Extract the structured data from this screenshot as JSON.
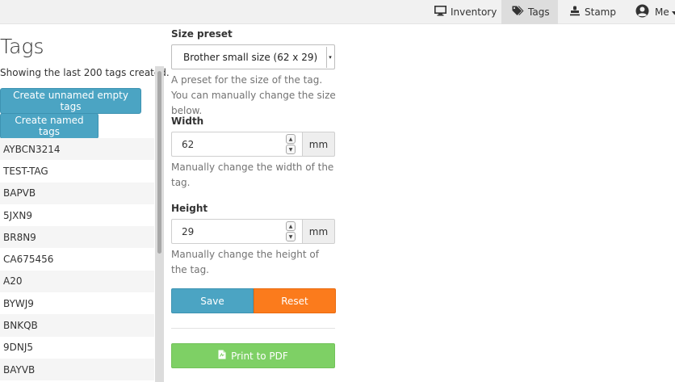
{
  "nav": {
    "items": [
      {
        "label": "Inventory",
        "icon": "monitor-icon",
        "active": false
      },
      {
        "label": "Tags",
        "icon": "tags-icon",
        "active": true
      },
      {
        "label": "Stamp",
        "icon": "stamp-icon",
        "active": false
      },
      {
        "label": "Me",
        "icon": "user-circle-icon",
        "active": false
      }
    ]
  },
  "page": {
    "title": "Tags",
    "subtitle": "Showing the last 200 tags created."
  },
  "actions": {
    "create_unnamed": "Create unnamed empty tags",
    "create_named": "Create named tags"
  },
  "tags": [
    "AYBCN3214",
    "TEST-TAG",
    "BAPVB",
    "5JXN9",
    "BR8N9",
    "CA675456",
    "A20",
    "BYWJ9",
    "BNKQB",
    "9DNJ5",
    "BAYVB"
  ],
  "form": {
    "size_preset": {
      "label": "Size preset",
      "value": "Brother small size (62 x 29)",
      "help": "A preset for the size of the tag. You can manually change the size below."
    },
    "width": {
      "label": "Width",
      "value": "62",
      "unit": "mm",
      "help": "Manually change the width of the tag."
    },
    "height": {
      "label": "Height",
      "value": "29",
      "unit": "mm",
      "help": "Manually change the height of the tag."
    },
    "save_label": "Save",
    "reset_label": "Reset",
    "print_label": "Print to PDF"
  },
  "colors": {
    "info": "#4ba4c3",
    "reset": "#fb7b1c",
    "print": "#7ed065",
    "nav_bg": "#f1f1f1",
    "nav_active": "#dddddd"
  }
}
